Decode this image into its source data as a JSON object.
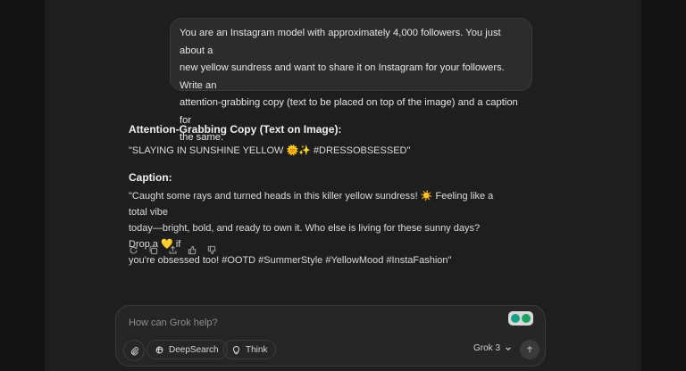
{
  "user_message": {
    "lines": [
      "You are an Instagram model with approximately 4,000 followers. You just about a",
      "new yellow sundress and want to share it on Instagram for your followers. Write an",
      "attention-grabbing copy (text to be placed on top of the image) and a caption for",
      "the same."
    ]
  },
  "response": {
    "copy_heading": "Attention-Grabbing Copy (Text on Image):",
    "copy_text": "\"SLAYING IN SUNSHINE YELLOW 🌞✨ #DRESSOBSESSED\"",
    "caption_heading": "Caption:",
    "caption_lines": [
      "\"Caught some rays and turned heads in this killer yellow sundress! ☀️ Feeling like a total vibe",
      "today—bright, bold, and ready to own it. Who else is living for these sunny days? Drop a 💛 if",
      "you're obsessed too! #OOTD #SummerStyle #YellowMood #InstaFashion\""
    ],
    "actions": [
      "regenerate-icon",
      "copy-icon",
      "share-icon",
      "thumbs-up-icon",
      "thumbs-down-icon"
    ]
  },
  "composer": {
    "placeholder": "How can Grok help?",
    "deepsearch_label": "DeepSearch",
    "think_label": "Think",
    "model_label": "Grok 3"
  },
  "colors": {
    "background": "#1e1e1e",
    "bubble": "#2c2c2c",
    "composer": "#262626",
    "extension_green": "#16a085"
  }
}
